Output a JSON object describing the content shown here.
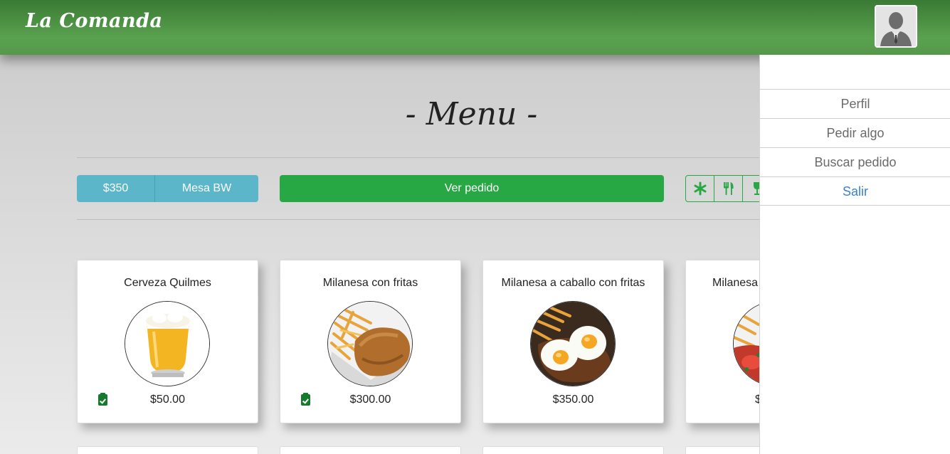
{
  "header": {
    "brand": "La Comanda",
    "avatar_icon": "user-avatar-icon"
  },
  "page": {
    "title": "- Menu -"
  },
  "toolbar": {
    "total": "$350",
    "table": "Mesa BW",
    "view_order": "Ver pedido",
    "filters": [
      {
        "icon": "asterisk-icon",
        "glyph": "*"
      },
      {
        "icon": "utensils-icon",
        "glyph": ""
      },
      {
        "icon": "wine-glass-icon",
        "glyph": ""
      }
    ]
  },
  "menu": {
    "items": [
      {
        "name": "Cerveza Quilmes",
        "price": "$50.00",
        "available": true,
        "image": "beer-glass"
      },
      {
        "name": "Milanesa con fritas",
        "price": "$300.00",
        "available": true,
        "image": "milanesa-fries"
      },
      {
        "name": "Milanesa a caballo con fritas",
        "price": "$350.00",
        "available": false,
        "image": "milanesa-eggs"
      },
      {
        "name": "Milanesa",
        "price": "$",
        "available": false,
        "image": "milanesa-napolitana"
      }
    ]
  },
  "sidemenu": {
    "items": [
      "Perfil",
      "Pedir algo",
      "Buscar pedido"
    ],
    "exit": "Salir"
  },
  "colors": {
    "header_green": "#4f9745",
    "info": "#5bb6c9",
    "success": "#28a745",
    "link": "#3a7fd0"
  }
}
